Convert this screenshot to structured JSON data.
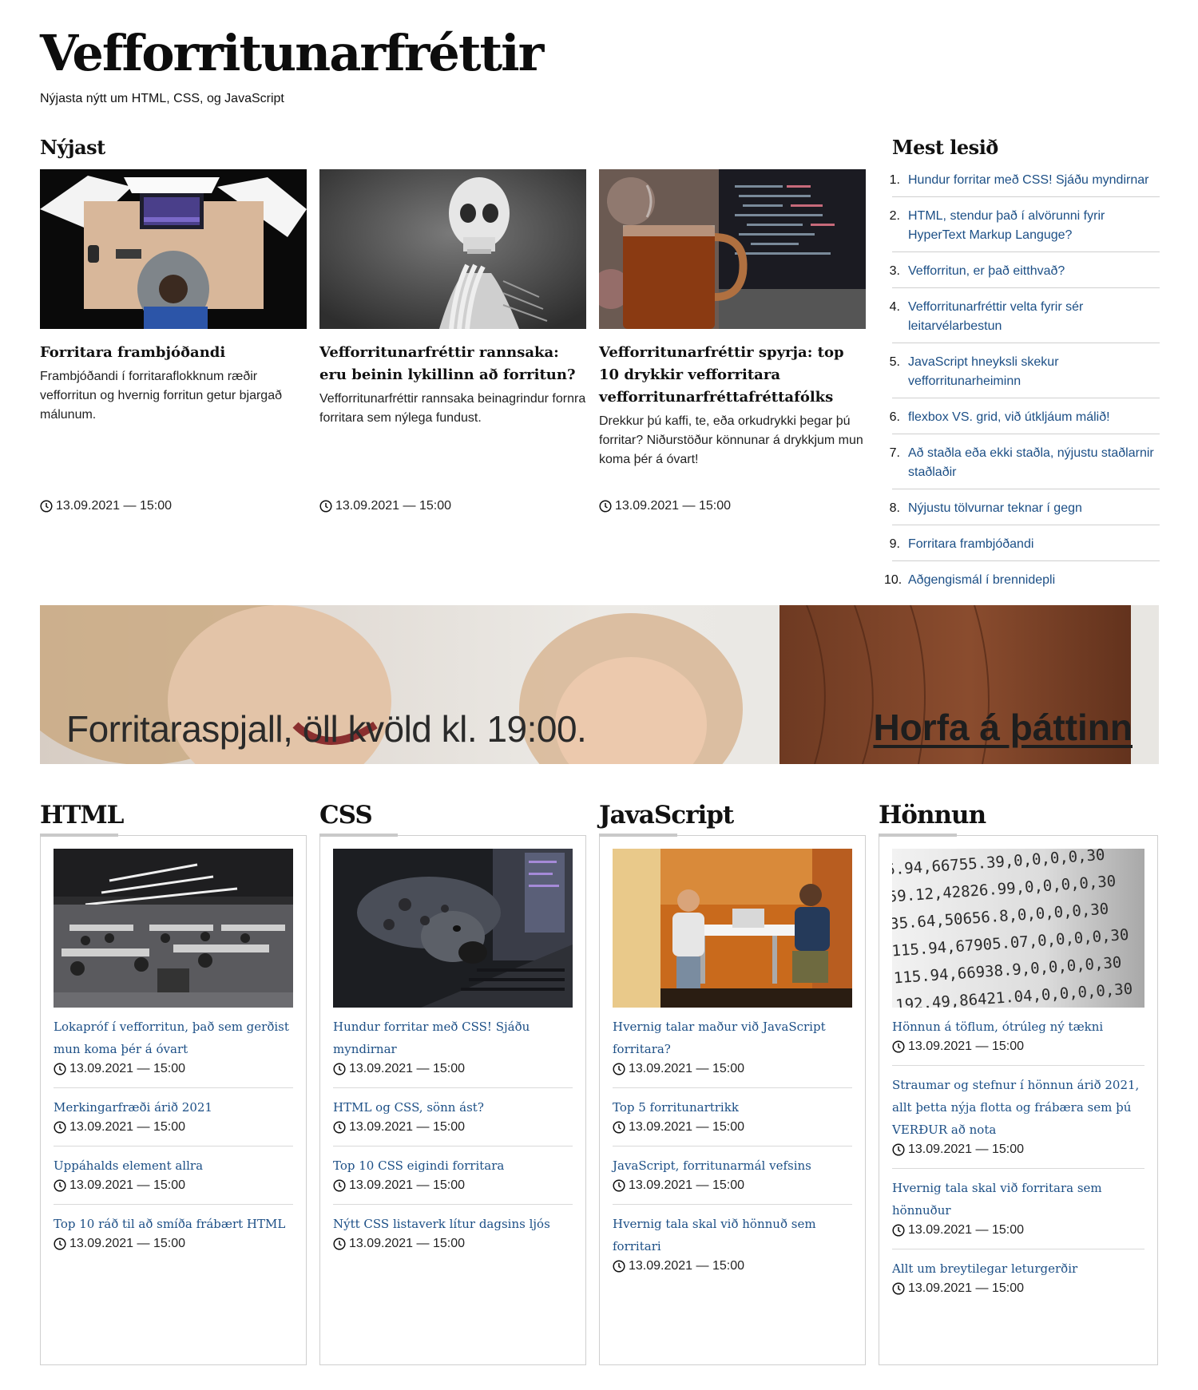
{
  "site": {
    "title": "Vefforritunarfréttir",
    "tagline": "Nýjasta nýtt um HTML, CSS, og JavaScript"
  },
  "latest": {
    "heading": "Nýjast",
    "articles": [
      {
        "title": "Forritara frambjóðandi",
        "text": "Frambjóðandi í forritaraflokknum ræðir vefforritun og hvernig forritun getur bjargað málunum.",
        "date": "13.09.2021 — 15:00",
        "image": "person-at-desk-photo"
      },
      {
        "title": "Vefforritunarfréttir rannsaka: eru beinin lykillinn að forritun?",
        "text": "Vefforritunarfréttir rannsaka beinagrindur fornra forritara sem nýlega fundust.",
        "date": "13.09.2021 — 15:00",
        "image": "skeleton-photo"
      },
      {
        "title": "Vefforritunarfréttir spyrja: top 10 drykkir vefforritara vefforritunarfréttafréttafólks",
        "text": "Drekkur þú kaffi, te, eða orkudrykki þegar þú forritar? Niðurstöður könnunar á drykkjum mun koma þér á óvart!",
        "date": "13.09.2021 — 15:00",
        "image": "tea-mug-photo"
      }
    ]
  },
  "most_read": {
    "heading": "Mest lesið",
    "items": [
      {
        "num": "1.",
        "label": "Hundur forritar með CSS! Sjáðu myndirnar"
      },
      {
        "num": "2.",
        "label": "HTML, stendur það í alvörunni fyrir HyperText Markup Languge?"
      },
      {
        "num": "3.",
        "label": "Vefforritun, er það eitthvað?"
      },
      {
        "num": "4.",
        "label": "Vefforritunarfréttir velta fyrir sér leitarvélarbestun"
      },
      {
        "num": "5.",
        "label": "JavaScript hneyksli skekur vefforritunarheiminn"
      },
      {
        "num": "6.",
        "label": "flexbox VS. grid, við útkljáum málið!"
      },
      {
        "num": "7.",
        "label": "Að staðla eða ekki staðla, nýjustu staðlarnir staðlaðir"
      },
      {
        "num": "8.",
        "label": "Nýjustu tölvurnar teknar í gegn"
      },
      {
        "num": "9.",
        "label": "Forritara frambjóðandi"
      },
      {
        "num": "10.",
        "label": "Aðgengismál í brennidepli"
      }
    ]
  },
  "banner": {
    "text": "Forritaraspjall, öll kvöld kl. 19:00.",
    "link": "Horfa á þáttinn"
  },
  "categories": [
    {
      "heading": "HTML",
      "image": "open-office-photo",
      "items": [
        {
          "title": "Lokapróf í vefforritun, það sem gerðist mun koma þér á óvart",
          "date": "13.09.2021 — 15:00"
        },
        {
          "title": "Merkingarfræði árið 2021",
          "date": "13.09.2021 — 15:00"
        },
        {
          "title": "Uppáhalds element allra",
          "date": "13.09.2021 — 15:00"
        },
        {
          "title": "Top 10 ráð til að smíða frábært HTML",
          "date": "13.09.2021 — 15:00"
        }
      ]
    },
    {
      "heading": "CSS",
      "image": "dog-laptop-photo",
      "items": [
        {
          "title": "Hundur forritar með CSS! Sjáðu myndirnar",
          "date": "13.09.2021 — 15:00"
        },
        {
          "title": "HTML og CSS, sönn ást?",
          "date": "13.09.2021 — 15:00"
        },
        {
          "title": "Top 10 CSS eigindi forritara",
          "date": "13.09.2021 — 15:00"
        },
        {
          "title": "Nýtt CSS listaverk lítur dagsins ljós",
          "date": "13.09.2021 — 15:00"
        }
      ]
    },
    {
      "heading": "JavaScript",
      "image": "two-people-meeting-photo",
      "items": [
        {
          "title": "Hvernig talar maður við JavaScript forritara?",
          "date": "13.09.2021 — 15:00"
        },
        {
          "title": "Top 5 forritunartrikk",
          "date": "13.09.2021 — 15:00"
        },
        {
          "title": "JavaScript, forritunarmál vefsins",
          "date": "13.09.2021 — 15:00"
        },
        {
          "title": "Hvernig tala skal við hönnuð sem forritari",
          "date": "13.09.2021 — 15:00"
        }
      ]
    },
    {
      "heading": "Hönnun",
      "image": "numbers-printout-photo",
      "items": [
        {
          "title": "Hönnun á töflum, ótrúleg ný tækni",
          "date": "13.09.2021 — 15:00"
        },
        {
          "title": "Straumar og stefnur í hönnun árið 2021, allt þetta nýja flotta og frábæra sem þú VERÐUR að nota",
          "date": "13.09.2021 — 15:00"
        },
        {
          "title": "Hvernig tala skal við forritara sem hönnuður",
          "date": "13.09.2021 — 15:00"
        },
        {
          "title": "Allt um breytilegar leturgerðir",
          "date": "13.09.2021 — 15:00"
        }
      ]
    }
  ],
  "colors": {
    "link": "#1c4f86",
    "text": "#111111",
    "divider": "#cfcfcf"
  }
}
